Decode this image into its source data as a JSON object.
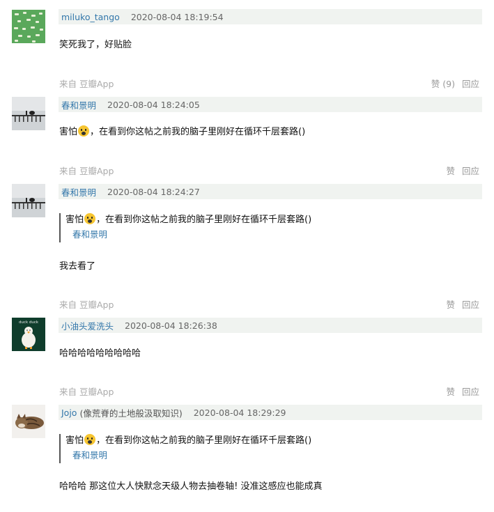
{
  "comments": [
    {
      "author": "miluko_tango",
      "author_extra": "",
      "time": "2020-08-04 18:19:54",
      "text": "笑死我了，好贴脸",
      "source": "来自 豆瓣App",
      "like": "赞 (9)",
      "reply": "回应",
      "avatar_icon": "green-pattern-avatar"
    },
    {
      "author": "春和景明",
      "author_extra": "",
      "time": "2020-08-04 18:24:05",
      "text_before": "害怕",
      "text_after": "，在看到你这帖之前我的脑子里刚好在循环千层套路()",
      "source": "来自 豆瓣App",
      "like": "赞",
      "reply": "回应",
      "avatar_icon": "bridge-silhouette-avatar"
    },
    {
      "author": "春和景明",
      "author_extra": "",
      "time": "2020-08-04 18:24:27",
      "quote_before": "害怕",
      "quote_after": "，在看到你这帖之前我的脑子里刚好在循环千层套路()",
      "quote_author": "春和景明",
      "text": "我去看了",
      "source": "来自 豆瓣App",
      "like": "赞",
      "reply": "回应",
      "avatar_icon": "bridge-silhouette-avatar"
    },
    {
      "author": "小油头爱洗头",
      "author_extra": "",
      "time": "2020-08-04 18:26:38",
      "text": "哈哈哈哈哈哈哈哈哈",
      "source": "来自 豆瓣App",
      "like": "赞",
      "reply": "回应",
      "avatar_icon": "duck-avatar",
      "avatar_text": "duck duck"
    },
    {
      "author": "Jojo",
      "author_extra": "(像荒脊的土地般汲取知识)",
      "time": "2020-08-04 18:29:29",
      "quote_before": "害怕",
      "quote_after": "，在看到你这帖之前我的脑子里刚好在循环千层套路()",
      "quote_author": "春和景明",
      "text": "哈哈哈 那这位大人快默念天级人物去抽卷轴! 没准这感应也能成真",
      "avatar_icon": "cat-avatar"
    }
  ]
}
